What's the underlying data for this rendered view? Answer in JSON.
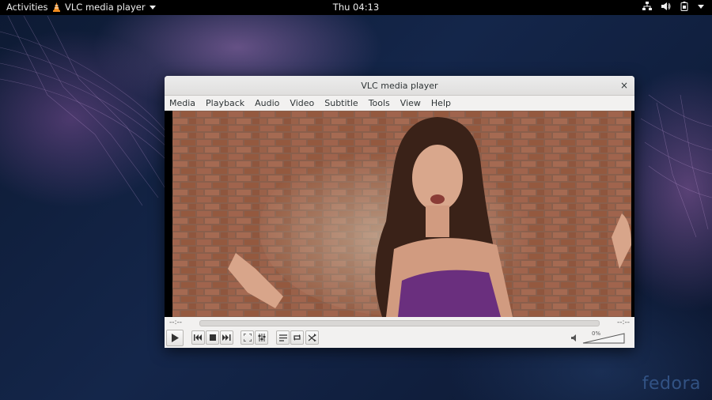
{
  "topbar": {
    "activities": "Activities",
    "app_menu": "VLC media player",
    "clock": "Thu 04:13",
    "tray_icons": [
      "network-icon",
      "volume-icon",
      "battery-icon",
      "system-menu-arrow-icon"
    ]
  },
  "window": {
    "title": "VLC media player",
    "close_glyph": "×",
    "menu": [
      "Media",
      "Playback",
      "Audio",
      "Video",
      "Subtitle",
      "Tools",
      "View",
      "Help"
    ],
    "elapsed_time": "--:--",
    "total_time": "--:--",
    "volume_label": "0%",
    "controls": [
      "play-icon",
      "previous-icon",
      "stop-icon",
      "next-icon",
      "fullscreen-icon",
      "extended-settings-icon",
      "playlist-icon",
      "loop-icon",
      "shuffle-icon"
    ]
  },
  "desktop": {
    "watermark": "fedora"
  },
  "colors": {
    "accent_vlc_orange": "#f28c1e",
    "topbar_bg": "#000000",
    "window_bg": "#f2f1f0"
  }
}
